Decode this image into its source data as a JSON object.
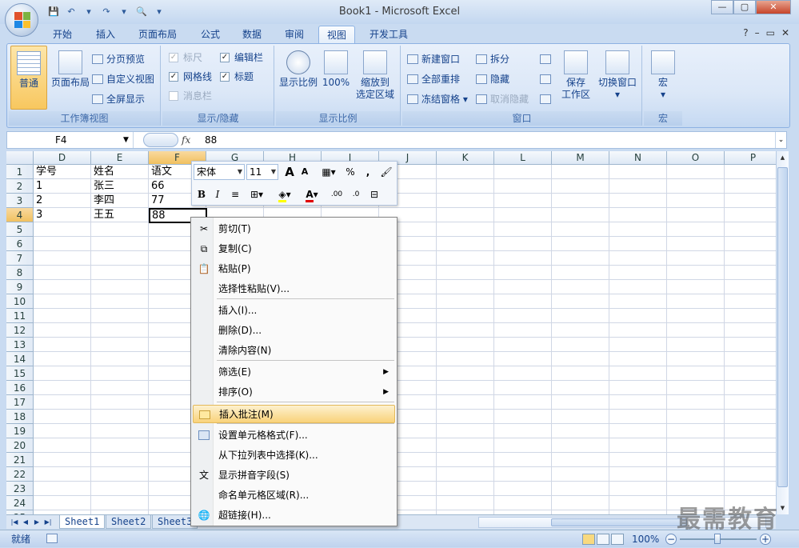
{
  "window": {
    "title": "Book1 - Microsoft Excel",
    "controls": [
      "—",
      "▢",
      "✕"
    ],
    "mdi_controls": [
      "?",
      "–",
      "▭",
      "✕"
    ]
  },
  "quick_access": [
    "💾",
    "↶",
    "▾",
    "↷",
    "▾",
    "🔍",
    "▾"
  ],
  "tabs": [
    {
      "label": "开始"
    },
    {
      "label": "插入"
    },
    {
      "label": "页面布局"
    },
    {
      "label": "公式"
    },
    {
      "label": "数据"
    },
    {
      "label": "审阅"
    },
    {
      "label": "视图",
      "active": true
    },
    {
      "label": "开发工具"
    }
  ],
  "ribbon": {
    "workbook_views": {
      "label": "工作簿视图",
      "normal": "普通",
      "page_layout": "页面布局",
      "page_break": "分页预览",
      "custom_view": "自定义视图",
      "full_screen": "全屏显示"
    },
    "show_hide": {
      "label": "显示/隐藏",
      "ruler": "标尺",
      "gridlines": "网格线",
      "message_bar": "消息栏",
      "formula_bar": "编辑栏",
      "headings": "标题",
      "check": "✓"
    },
    "zoom": {
      "label": "显示比例",
      "zoom": "显示比例",
      "zoom100": "100%",
      "zoom_sel_1": "缩放到",
      "zoom_sel_2": "选定区域"
    },
    "window": {
      "label": "窗口",
      "new_window": "新建窗口",
      "arrange_all": "全部重排",
      "freeze": "冻结窗格",
      "split": "拆分",
      "hide": "隐藏",
      "unhide": "取消隐藏",
      "save_ws_1": "保存",
      "save_ws_2": "工作区",
      "switch_windows": "切换窗口"
    },
    "macros": {
      "label": "宏",
      "macros": "宏"
    }
  },
  "formula_bar": {
    "name_box": "F4",
    "fx": "fx",
    "value": "88"
  },
  "sheet": {
    "columns": [
      "D",
      "E",
      "F",
      "G",
      "H",
      "I",
      "J",
      "K",
      "L",
      "M",
      "N",
      "O",
      "P"
    ],
    "selected_column": "F",
    "selected_row": "4",
    "rows": [
      "1",
      "2",
      "3",
      "4",
      "5",
      "6",
      "7",
      "8",
      "9",
      "10",
      "11",
      "12",
      "13",
      "14",
      "15",
      "16",
      "17",
      "18",
      "19",
      "20",
      "21",
      "22",
      "23",
      "24",
      "25"
    ],
    "cells": {
      "D1": "学号",
      "E1": "姓名",
      "F1": "语文",
      "D2": "1",
      "E2": "张三",
      "F2": "66",
      "D3": "2",
      "E3": "李四",
      "F3": "77",
      "D4": "3",
      "E4": "王五",
      "F4": "88"
    },
    "tabs": [
      "Sheet1",
      "Sheet2",
      "Sheet3"
    ],
    "active_tab": "Sheet1"
  },
  "mini_toolbar": {
    "font": "宋体",
    "size": "11",
    "grow": "A",
    "shrink": "A",
    "percent": "%",
    "comma": ",",
    "bold": "B",
    "italic": "I",
    "align": "≡",
    "font_color": "A",
    "inc_decimal": ".00",
    "dec_decimal": ".0"
  },
  "context_menu": [
    {
      "label": "剪切(T)",
      "icon": "scissors-icon",
      "glyph": "✂"
    },
    {
      "label": "复制(C)",
      "icon": "copy-icon",
      "glyph": "⧉"
    },
    {
      "label": "粘贴(P)",
      "icon": "paste-icon",
      "glyph": "📋"
    },
    {
      "label": "选择性粘贴(V)..."
    },
    {
      "label": "插入(I)..."
    },
    {
      "label": "删除(D)..."
    },
    {
      "label": "清除内容(N)"
    },
    {
      "label": "筛选(E)",
      "submenu": true
    },
    {
      "label": "排序(O)",
      "submenu": true
    },
    {
      "label": "插入批注(M)",
      "icon": "comment-icon",
      "highlighted": true
    },
    {
      "label": "设置单元格格式(F)...",
      "icon": "format-cells-icon"
    },
    {
      "label": "从下拉列表中选择(K)..."
    },
    {
      "label": "显示拼音字段(S)",
      "icon": "phonetic-icon",
      "glyph": "文"
    },
    {
      "label": "命名单元格区域(R)..."
    },
    {
      "label": "超链接(H)...",
      "icon": "hyperlink-icon",
      "glyph": "🌐"
    }
  ],
  "status": {
    "ready": "就绪",
    "zoom": "100%",
    "minus": "−",
    "plus": "+"
  },
  "watermark": "最需教育",
  "colors": {
    "ribbon_bg": "#dbe7f7",
    "accent": "#15428b",
    "selected_header": "#f1c15f",
    "menu_highlight": "#f9d27a"
  }
}
